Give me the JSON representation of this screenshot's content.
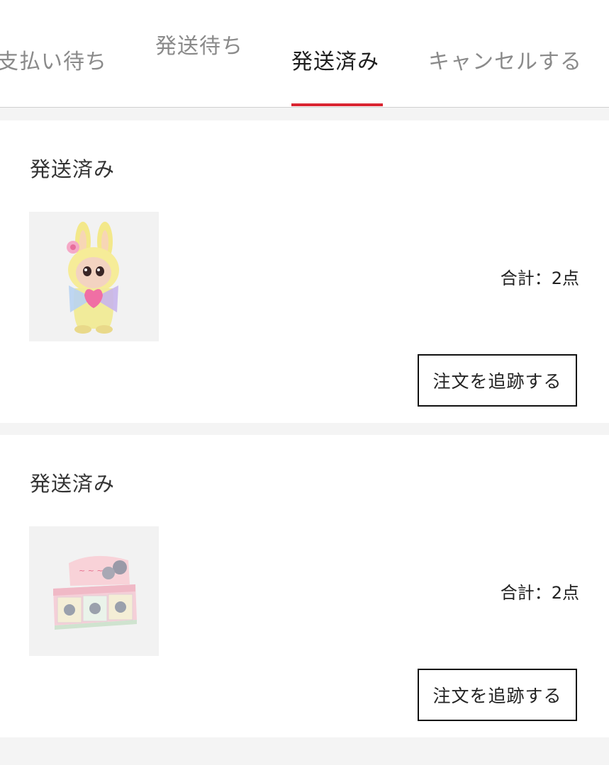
{
  "tabs": [
    {
      "label": "支払い待ち",
      "active": false
    },
    {
      "label": "発送待ち",
      "active": false
    },
    {
      "label": "発送済み",
      "active": true
    },
    {
      "label": "キャンセルする",
      "active": false
    }
  ],
  "accent_color": "#d92531",
  "orders": [
    {
      "status": "発送済み",
      "total_label": "合計：",
      "total_count": "2点",
      "track_label": "注文を追跡する",
      "thumbnail": "yellow-bunny-figure-image"
    },
    {
      "status": "発送済み",
      "total_label": "合計：",
      "total_count": "2点",
      "track_label": "注文を追跡する",
      "thumbnail": "blind-box-set-image"
    }
  ]
}
